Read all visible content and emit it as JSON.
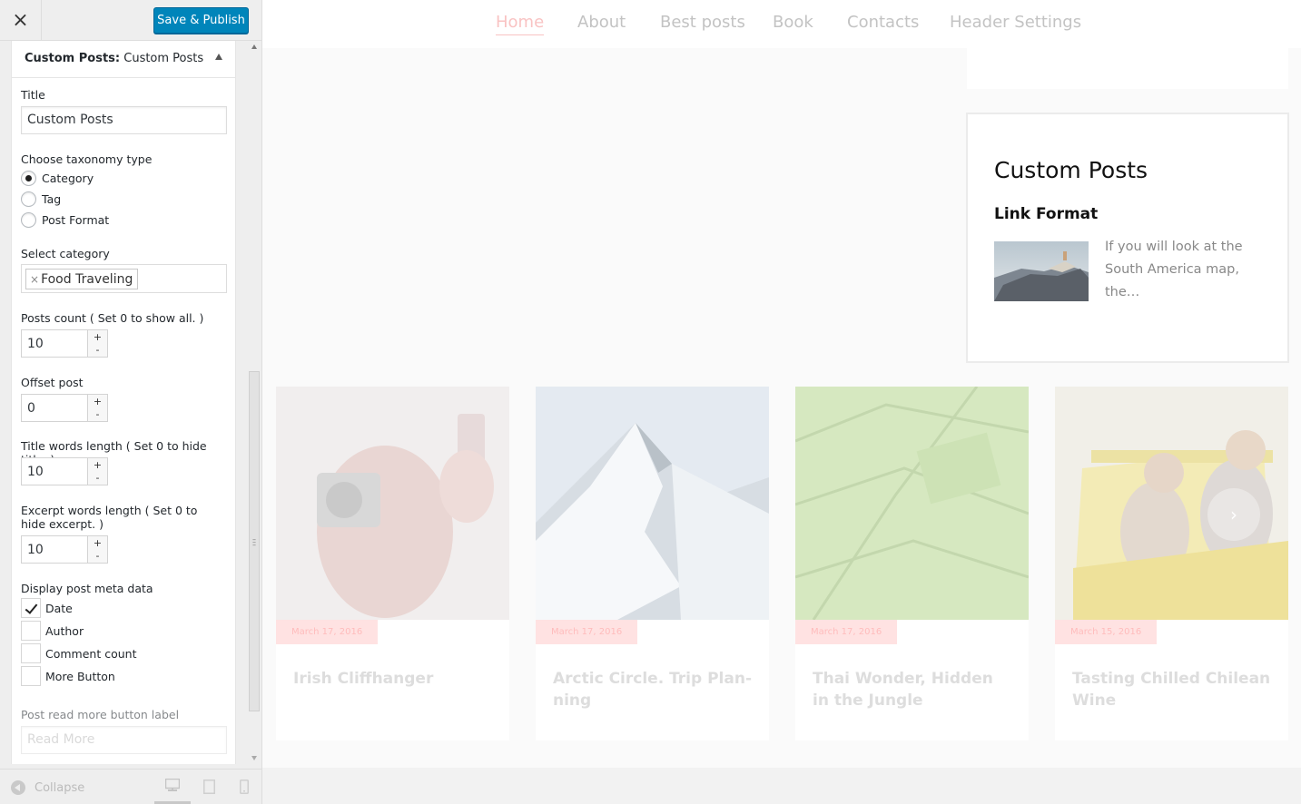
{
  "sidebar": {
    "close_label": "×",
    "save_label": "Save & Publish",
    "widget_header": {
      "name": "Custom Posts:",
      "title": "Custom Posts"
    },
    "form": {
      "title_label": "Title",
      "title_value": "Custom Posts",
      "taxonomy_label": "Choose taxonomy type",
      "taxonomy_options": [
        "Category",
        "Tag",
        "Post Format"
      ],
      "taxonomy_selected": "Category",
      "category_label": "Select category",
      "category_selected": "Food Traveling",
      "posts_count_label": "Posts count ( Set 0 to show all. )",
      "posts_count_value": "10",
      "offset_label": "Offset post",
      "offset_value": "0",
      "title_words_label": "Title words length ( Set 0 to hide title. )",
      "title_words_value": "10",
      "excerpt_words_label": "Excerpt words length ( Set 0 to hide excerpt. )",
      "excerpt_words_value": "10",
      "meta_label": "Display post meta data",
      "meta_options": [
        {
          "label": "Date",
          "checked": true
        },
        {
          "label": "Author",
          "checked": false
        },
        {
          "label": "Comment count",
          "checked": false
        },
        {
          "label": "More Button",
          "checked": false
        }
      ],
      "read_more_label": "Post read more button label",
      "read_more_placeholder": "Read More",
      "spin_up": "+",
      "spin_down": "-"
    },
    "footer": {
      "collapse_label": "Collapse"
    }
  },
  "preview": {
    "nav": [
      "Home",
      "About",
      "Best posts",
      "Book",
      "Contacts",
      "Header Settings"
    ],
    "nav_active": "Home",
    "widget": {
      "heading": "Custom Posts",
      "post_title": "Link Format",
      "excerpt": "If you will look at the South America map, the…"
    },
    "posts": [
      {
        "date": "March 17, 2016",
        "title": "Irish Cliffhanger"
      },
      {
        "date": "March 17, 2016",
        "title": "Arctic Circle. Trip Plan-ning"
      },
      {
        "date": "March 17, 2016",
        "title": "Thai Wonder, Hidden in the Jungle"
      },
      {
        "date": "March 15, 2016",
        "title": "Tasting Chilled Chilean Wine"
      }
    ],
    "carousel_next": "›"
  },
  "colors": {
    "publish_button": "#0085ba",
    "nav_active": "#f9c3c3",
    "date_badge_bg": "#ffe2e2"
  }
}
